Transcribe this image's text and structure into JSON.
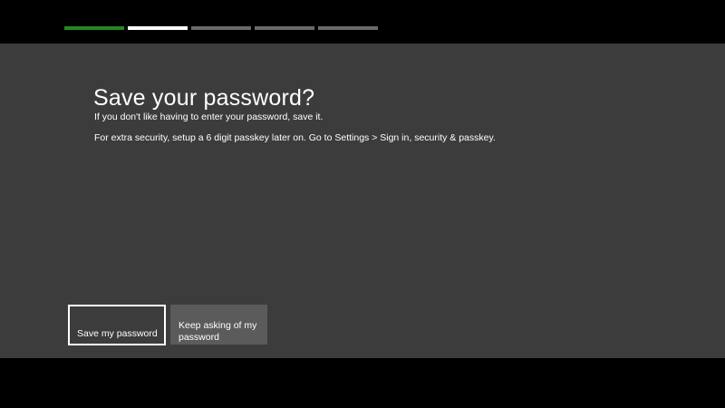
{
  "progress": {
    "total_steps": 5,
    "current_step": 2,
    "colors": {
      "completed": "#1f8b24",
      "current": "#ffffff",
      "pending": "#6a6a6a"
    }
  },
  "dialog": {
    "title": "Save your password?",
    "description_1": "If you don't like having to enter your password, save it.",
    "description_2": "For extra security, setup a 6 digit passkey later on. Go to Settings > Sign in, security & passkey."
  },
  "buttons": {
    "save_label": "Save my password",
    "keep_asking_label": "Keep asking of my password"
  },
  "colors": {
    "panel_background": "#3c3c3c",
    "secondary_button": "#5b5b5b",
    "screen_background": "#000000"
  }
}
